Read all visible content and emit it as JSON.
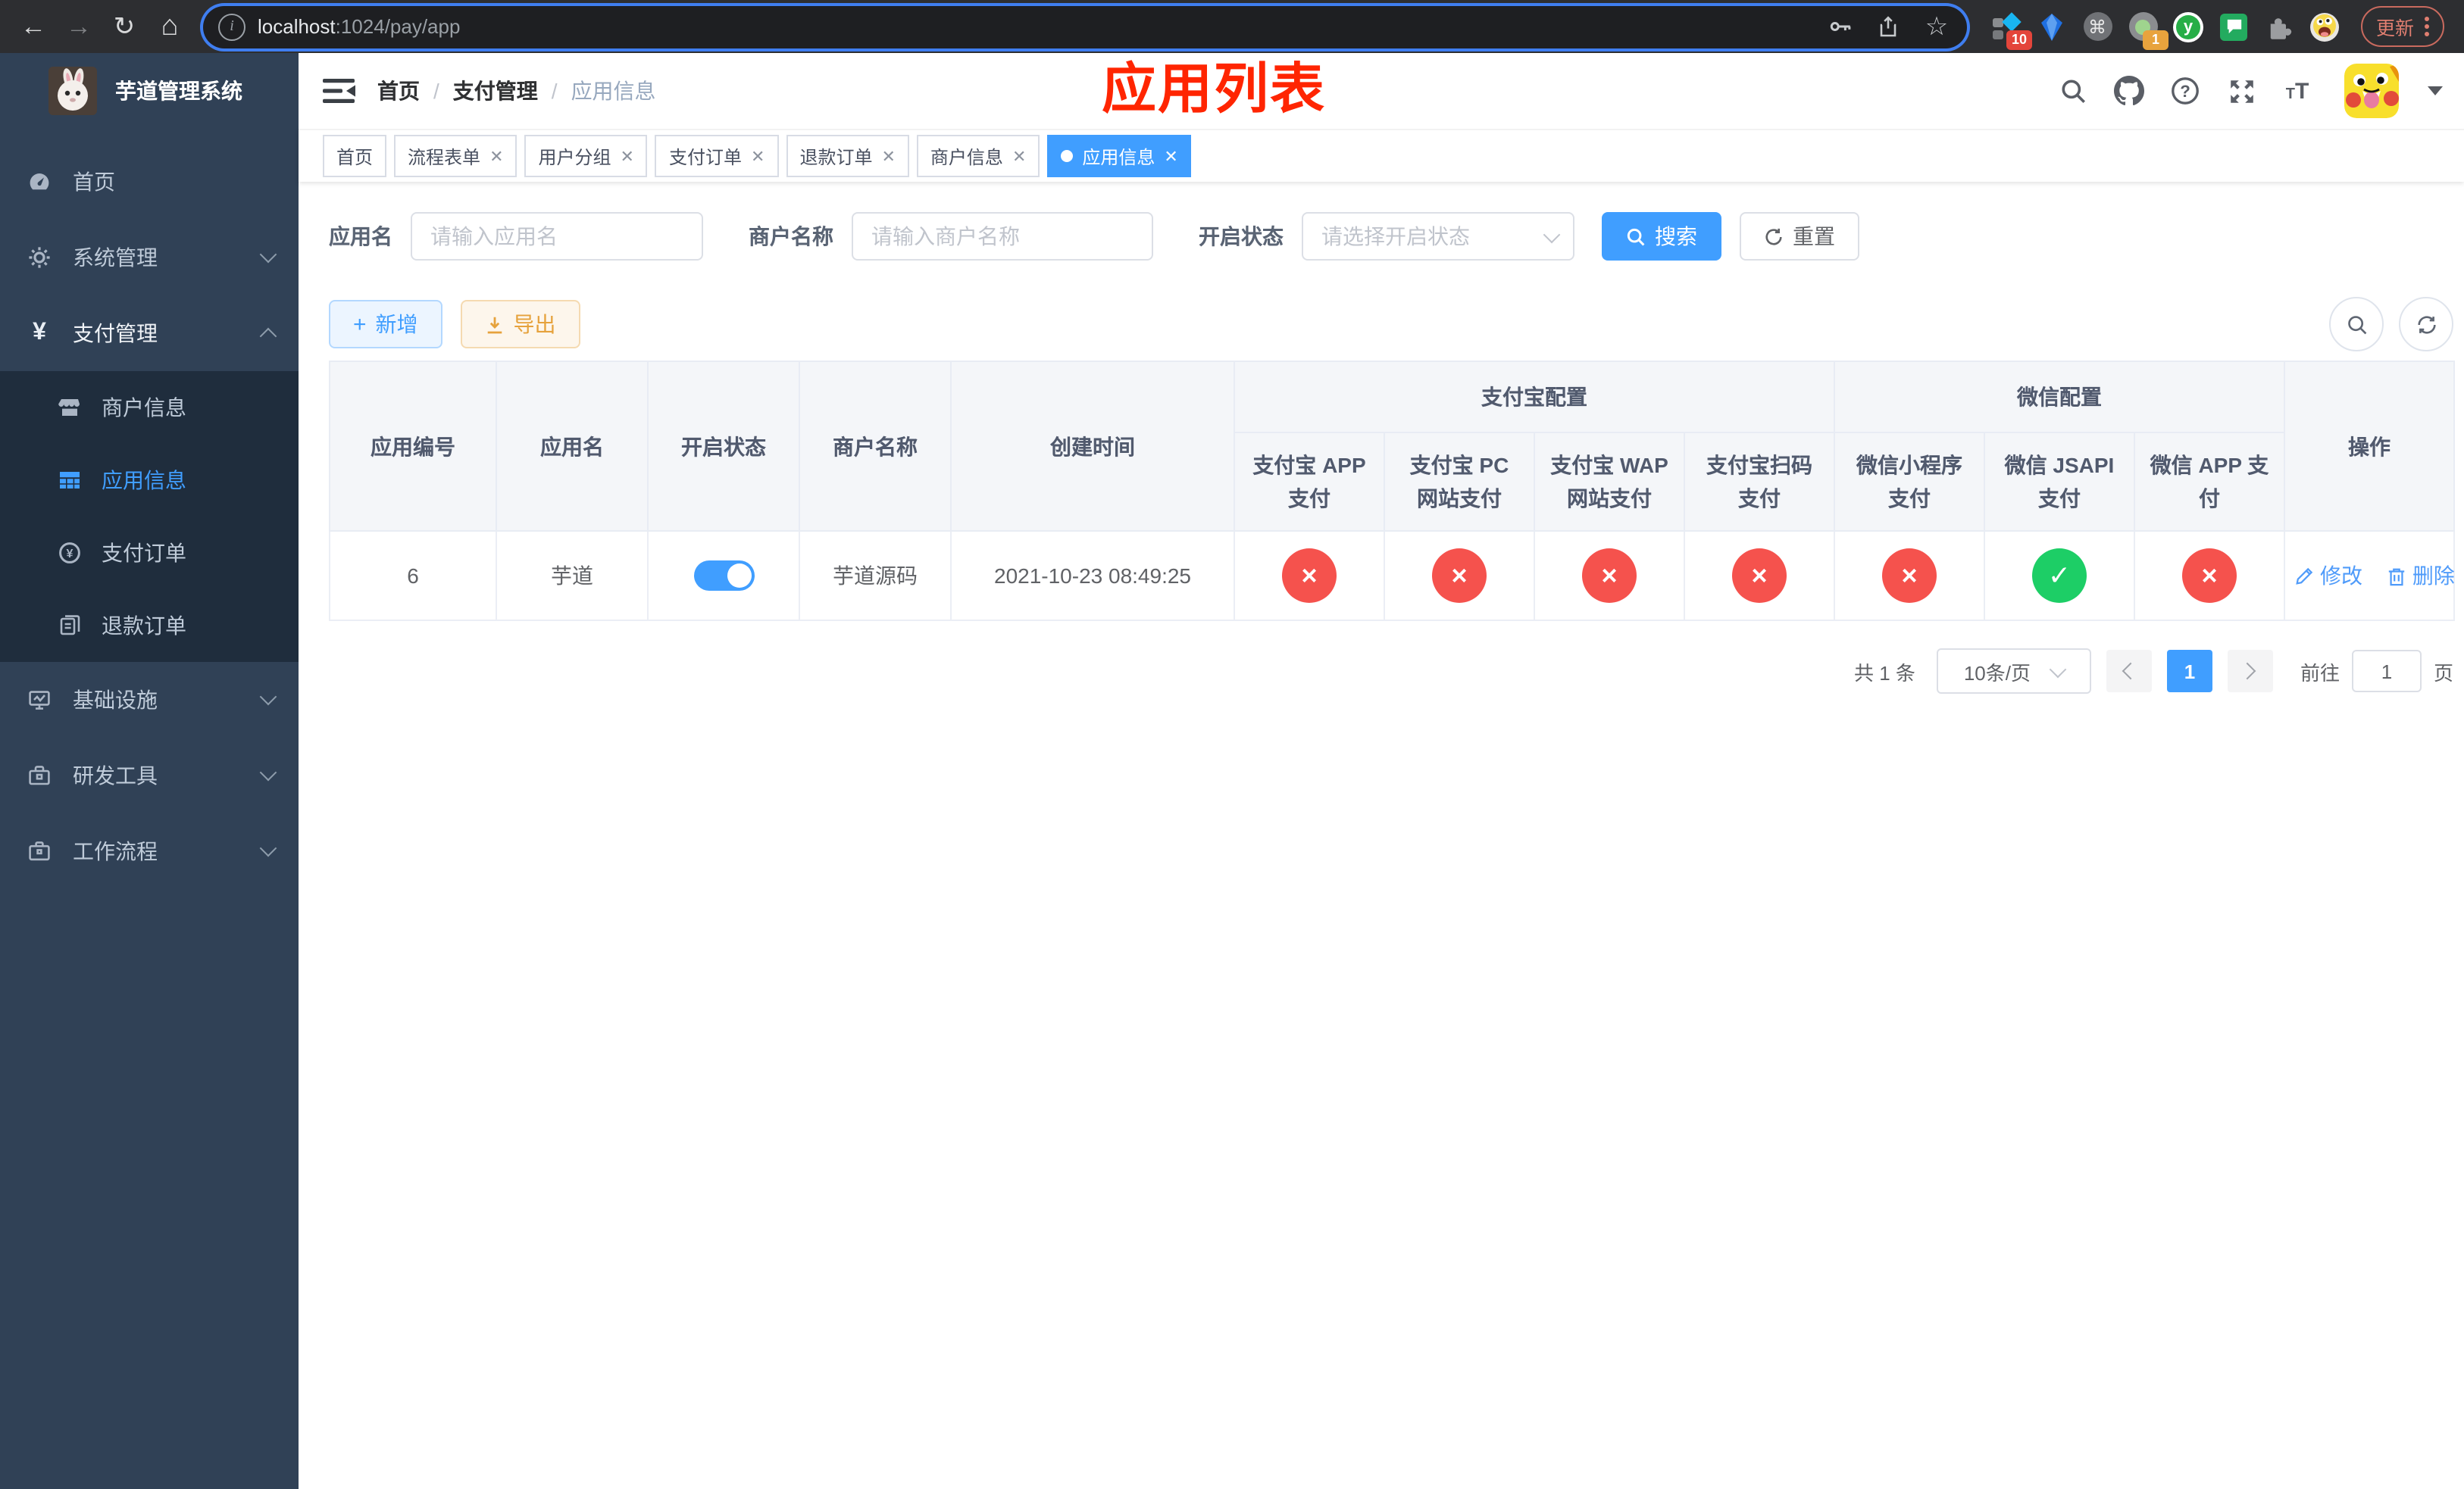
{
  "browser": {
    "url_host": "localhost",
    "url_path": ":1024/pay/app",
    "update_label": "更新",
    "extensions": {
      "badge_first": "10",
      "badge_second": "1"
    },
    "glyphs": {
      "back": "←",
      "forward": "→",
      "reload": "↻",
      "home": "⌂",
      "command": "⌘",
      "star": "☆",
      "info": "i"
    }
  },
  "sidebar": {
    "title": "芋道管理系统",
    "items": [
      {
        "label": "首页"
      },
      {
        "label": "系统管理"
      },
      {
        "label": "支付管理"
      },
      {
        "label": "基础设施"
      },
      {
        "label": "研发工具"
      },
      {
        "label": "工作流程"
      }
    ],
    "pay_children": [
      {
        "label": "商户信息"
      },
      {
        "label": "应用信息"
      },
      {
        "label": "支付订单"
      },
      {
        "label": "退款订单"
      }
    ]
  },
  "navbar": {
    "breadcrumb": [
      "首页",
      "支付管理",
      "应用信息"
    ],
    "annotation": "应用列表"
  },
  "tabs": [
    {
      "label": "首页"
    },
    {
      "label": "流程表单"
    },
    {
      "label": "用户分组"
    },
    {
      "label": "支付订单"
    },
    {
      "label": "退款订单"
    },
    {
      "label": "商户信息"
    },
    {
      "label": "应用信息"
    }
  ],
  "filter": {
    "app_name_label": "应用名",
    "app_name_placeholder": "请输入应用名",
    "merchant_label": "商户名称",
    "merchant_placeholder": "请输入商户名称",
    "status_label": "开启状态",
    "status_placeholder": "请选择开启状态",
    "search_label": "搜索",
    "reset_label": "重置"
  },
  "toolbar": {
    "add_label": "新增",
    "export_label": "导出"
  },
  "table": {
    "columns": [
      "应用编号",
      "应用名",
      "开启状态",
      "商户名称",
      "创建时间"
    ],
    "groups": {
      "alipay": "支付宝配置",
      "wechat": "微信配置"
    },
    "sub_columns": [
      "支付宝 APP 支付",
      "支付宝 PC 网站支付",
      "支付宝 WAP 网站支付",
      "支付宝扫码支付",
      "微信小程序支付",
      "微信 JSAPI 支付",
      "微信 APP 支付"
    ],
    "actions_column": "操作",
    "row": {
      "id": "6",
      "name": "芋道",
      "enabled": true,
      "merchant": "芋道源码",
      "created": "2021-10-23 08:49:25",
      "statuses": [
        "no",
        "no",
        "no",
        "no",
        "no",
        "yes",
        "no"
      ],
      "edit_label": "修改",
      "delete_label": "删除"
    }
  },
  "pagination": {
    "total": "共 1 条",
    "page_size": "10条/页",
    "page": "1",
    "goto_label": "前往",
    "goto_value": "1",
    "page_unit": "页"
  }
}
